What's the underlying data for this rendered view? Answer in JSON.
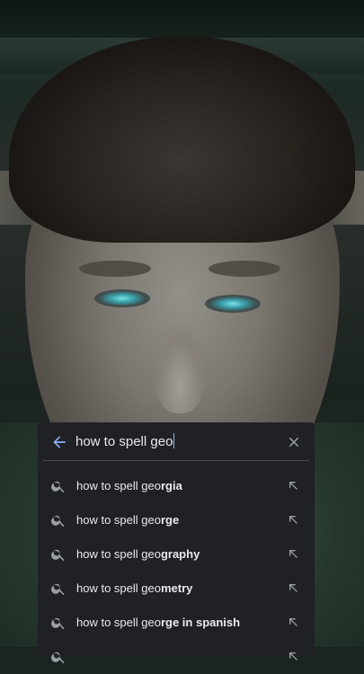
{
  "background": {
    "description_icon": "video-frame"
  },
  "search": {
    "query": "how to spell geo"
  },
  "suggestions": [
    {
      "prefix": "how to spell geo",
      "completion": "rgia"
    },
    {
      "prefix": "how to spell geo",
      "completion": "rge"
    },
    {
      "prefix": "how to spell geo",
      "completion": "graphy"
    },
    {
      "prefix": "how to spell geo",
      "completion": "metry"
    },
    {
      "prefix": "how to spell geo",
      "completion": "rge in spanish"
    }
  ],
  "icons": {
    "back": "arrow-left-icon",
    "clear": "close-icon",
    "suggestion": "search-icon",
    "fill": "arrow-up-left-icon"
  },
  "colors": {
    "panel": "#202124",
    "text": "#e8eaed",
    "accent": "#8ab4f8",
    "icon": "#9aa0a6"
  }
}
